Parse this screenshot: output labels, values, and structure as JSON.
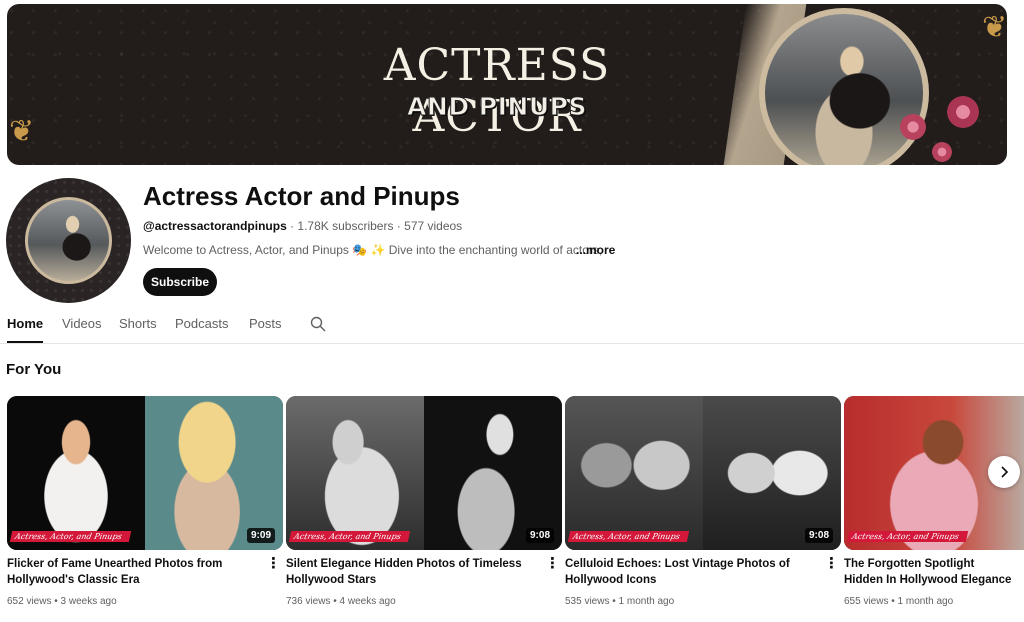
{
  "banner": {
    "title": "ACTRESS ACTOR",
    "subtitle": "AND PINUPS"
  },
  "channel": {
    "name": "Actress Actor and Pinups",
    "handle": "@actressactorandpinups",
    "subscribers": "1.78K subscribers",
    "videos": "577 videos",
    "separator": " · ",
    "description": "Welcome to Actress, Actor, and Pinups 🎭 ✨ Dive into the enchanting world of actors,",
    "more": "...more",
    "subscribe_label": "Subscribe"
  },
  "tabs": [
    {
      "label": "Home",
      "active": true
    },
    {
      "label": "Videos",
      "active": false
    },
    {
      "label": "Shorts",
      "active": false
    },
    {
      "label": "Podcasts",
      "active": false
    },
    {
      "label": "Posts",
      "active": false
    }
  ],
  "section_title": "For You",
  "watermark": "Actress, Actor, and Pinups",
  "videos": [
    {
      "title": "Flicker of Fame Unearthed Photos from Hollywood's Classic Era",
      "duration": "9:09",
      "views": "652 views",
      "age": "3 weeks ago"
    },
    {
      "title": "Silent Elegance Hidden Photos of Timeless Hollywood Stars",
      "duration": "9:08",
      "views": "736 views",
      "age": "4 weeks ago"
    },
    {
      "title": "Celluloid Echoes: Lost Vintage Photos of Hollywood Icons",
      "duration": "9:08",
      "views": "535 views",
      "age": "1 month ago"
    },
    {
      "title": "The Forgotten Spotlight Hidden In Hollywood Elegance",
      "duration": "",
      "views": "655 views",
      "age": "1 month ago"
    }
  ],
  "meta_dot": " • ",
  "colors": {
    "accent": "#0f0f0f",
    "watermark": "#d3183a",
    "banner_bg": "#221d1b"
  },
  "icons": [
    "search-icon",
    "kebab-menu-icon",
    "chevron-right-icon"
  ]
}
